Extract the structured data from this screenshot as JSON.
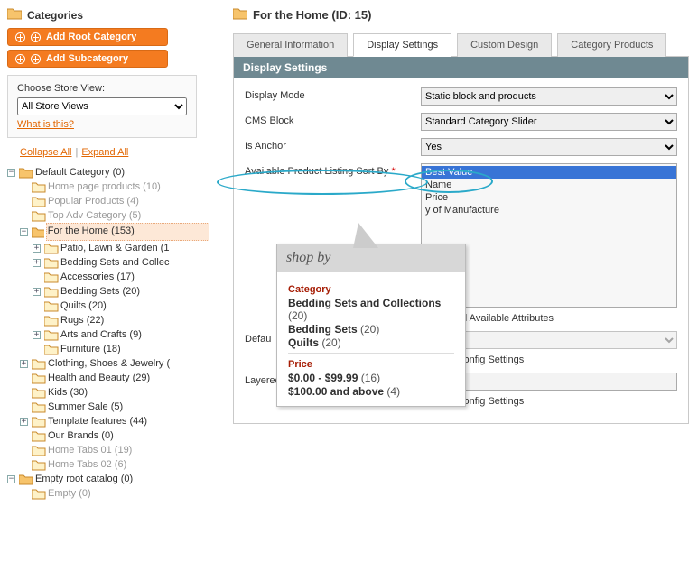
{
  "side": {
    "title": "Categories",
    "btn_root": "Add Root Category",
    "btn_sub": "Add Subcategory",
    "store_label": "Choose Store View:",
    "store_value": "All Store Views",
    "what": "What is this?",
    "collapse": "Collapse All",
    "expand": "Expand All"
  },
  "tree": {
    "root": "Default Category (0)",
    "items": [
      {
        "t": "Home page products (10)",
        "g": 1
      },
      {
        "t": "Popular Products (4)",
        "g": 1
      },
      {
        "t": "Top Adv Category (5)",
        "g": 1
      },
      {
        "t": "For the Home (153)",
        "sel": 1,
        "exp": "−",
        "children": [
          {
            "t": "Patio, Lawn & Garden (1",
            "exp": "+"
          },
          {
            "t": "Bedding Sets and Collec",
            "exp": "+"
          },
          {
            "t": "Accessories (17)"
          },
          {
            "t": "Bedding Sets (20)",
            "exp": "+"
          },
          {
            "t": "Quilts (20)"
          },
          {
            "t": "Rugs (22)"
          },
          {
            "t": "Arts and Crafts (9)",
            "exp": "+"
          },
          {
            "t": "Furniture (18)"
          }
        ]
      },
      {
        "t": "Clothing, Shoes & Jewelry (",
        "exp": "+"
      },
      {
        "t": "Health and Beauty (29)"
      },
      {
        "t": "Kids (30)"
      },
      {
        "t": "Summer Sale (5)"
      },
      {
        "t": "Template features (44)",
        "exp": "+"
      },
      {
        "t": "Our Brands (0)"
      },
      {
        "t": "Home Tabs 01 (19)",
        "g": 1
      },
      {
        "t": "Home Tabs 02 (6)",
        "g": 1
      }
    ],
    "root2": "Empty root catalog (0)",
    "empty": "Empty (0)"
  },
  "main": {
    "title": "For the Home (ID: 15)",
    "tabs": [
      "General Information",
      "Display Settings",
      "Custom Design",
      "Category Products"
    ],
    "panel_title": "Display Settings",
    "rows": {
      "display_mode": {
        "label": "Display Mode",
        "value": "Static block and products"
      },
      "cms_block": {
        "label": "CMS Block",
        "value": "Standard Category Slider"
      },
      "is_anchor": {
        "label": "Is Anchor",
        "value": "Yes"
      },
      "sort_by": {
        "label": "Available Product Listing Sort By",
        "options": [
          "Best Value",
          "Name",
          "Price",
          "y of Manufacture"
        ],
        "use_all": "Use All Available Attributes"
      },
      "default_sort": {
        "label": "Defau",
        "value": "alue",
        "use_cfg": "Use Config Settings"
      },
      "price_step": {
        "label": "Layered Navigation Price Step",
        "use_cfg": "Use Config Settings"
      }
    }
  },
  "popup": {
    "title": "shop by",
    "cat_label": "Category",
    "cats": [
      {
        "name": "Bedding Sets and Collections",
        "count": "(20)"
      },
      {
        "name": "Bedding Sets",
        "count": "(20)"
      },
      {
        "name": "Quilts",
        "count": "(20)"
      }
    ],
    "price_label": "Price",
    "prices": [
      {
        "range": "$0.00 - $99.99",
        "count": "(16)"
      },
      {
        "range": "$100.00 and above",
        "count": "(4)"
      }
    ]
  }
}
